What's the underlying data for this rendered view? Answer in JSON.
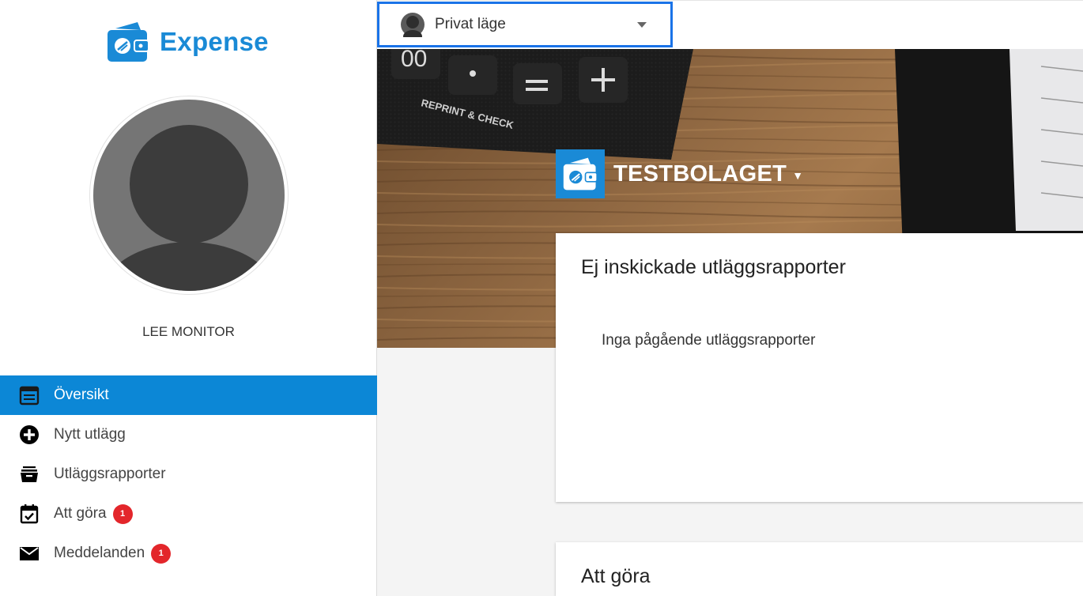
{
  "app": {
    "logo_text": "Expense"
  },
  "user": {
    "name": "LEE MONITOR"
  },
  "nav": {
    "items": [
      {
        "label": "Översikt",
        "icon": "calendar-list-icon",
        "active": true,
        "badge": ""
      },
      {
        "label": "Nytt utlägg",
        "icon": "plus-circle-icon",
        "active": false,
        "badge": ""
      },
      {
        "label": "Utläggsrapporter",
        "icon": "archive-icon",
        "active": false,
        "badge": ""
      },
      {
        "label": "Att göra",
        "icon": "calendar-check-icon",
        "active": false,
        "badge": "1"
      },
      {
        "label": "Meddelanden",
        "icon": "envelope-icon",
        "active": false,
        "badge": "1"
      }
    ]
  },
  "topbar": {
    "mode_label": "Privat läge"
  },
  "hero": {
    "company_name": "TESTBOLAGET"
  },
  "cards": {
    "unsent": {
      "title": "Ej inskickade utläggsrapporter",
      "empty_text": "Inga pågående utläggsrapporter"
    },
    "todo": {
      "title": "Att göra"
    }
  },
  "colors": {
    "accent": "#0c87d6",
    "brand": "#1a8ad6",
    "badge": "#e3262b",
    "focus": "#1a73e8"
  }
}
